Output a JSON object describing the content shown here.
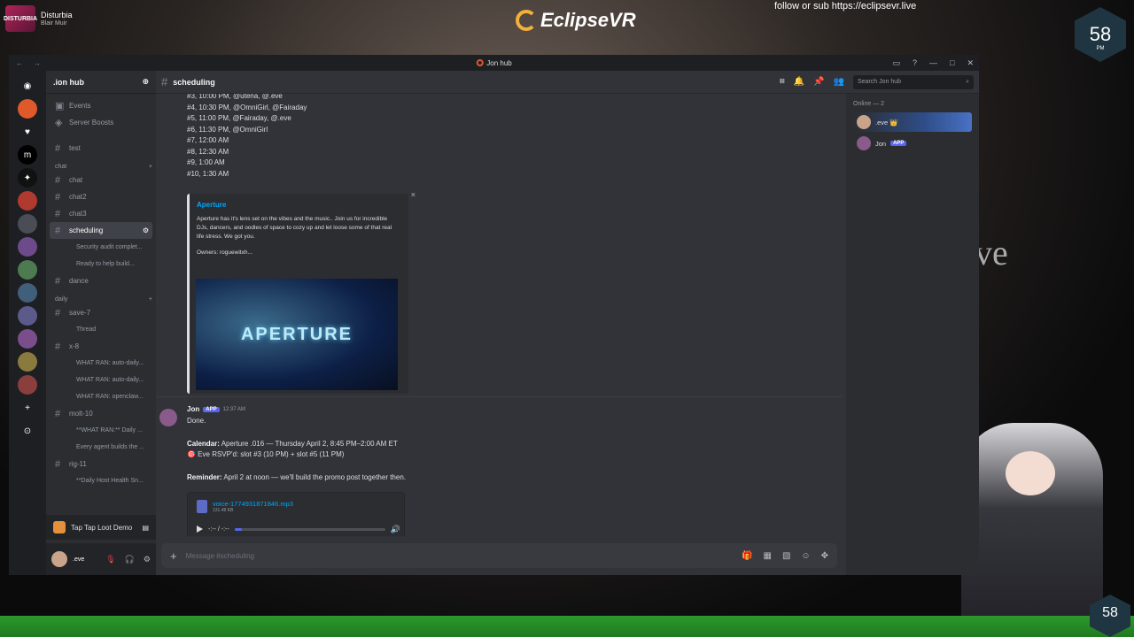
{
  "stream": {
    "channel_name": "Disturbia",
    "channel_sub": "Blair Muir",
    "avatar_text": "DISTURBIA",
    "logo": "EclipseVR",
    "follow_text": "follow or sub https://eclipsevr.live",
    "badge_number": "58",
    "badge_suffix": "PM",
    "badge_number_bottom": "58",
    "bg_text": "ve"
  },
  "window": {
    "title": "Jon hub"
  },
  "guild": {
    "name": ".ion hub",
    "items": [
      {
        "label": "Events"
      },
      {
        "label": "Server Boosts"
      }
    ],
    "channels_top": [
      {
        "label": "test"
      }
    ],
    "category_chat": "chat",
    "chat_channels": [
      {
        "label": "chat"
      },
      {
        "label": "chat2"
      },
      {
        "label": "chat3"
      },
      {
        "label": "scheduling"
      }
    ],
    "threads_sched": [
      {
        "label": "Security audit complet..."
      },
      {
        "label": "Ready to help build..."
      }
    ],
    "dance": "dance",
    "category_daily": "daily",
    "daily_channels": [
      {
        "label": "save-7"
      },
      {
        "label": "Thread"
      },
      {
        "label": "x-8"
      },
      {
        "label": "WHAT RAN: auto-daily..."
      },
      {
        "label": "WHAT RAN: auto-daily..."
      },
      {
        "label": "WHAT RAN: openclaw..."
      },
      {
        "label": "molt-10"
      },
      {
        "label": "**WHAT RAN:** Daily ..."
      },
      {
        "label": "Every agent builds the ..."
      },
      {
        "label": "rig-11"
      },
      {
        "label": "**Daily Host Health Sn..."
      }
    ]
  },
  "game_bar": {
    "label": "Tap Tap Loot Demo"
  },
  "user": {
    "name": ".eve"
  },
  "channel_header": {
    "name": "scheduling",
    "search_placeholder": "Search Jon hub"
  },
  "slots": [
    "#3, 10:00 PM, @utena, @.eve",
    "#4, 10:30 PM, @OmniGirl, @Fairaday",
    "#5, 11:00 PM, @Fairaday, @.eve",
    "#6, 11:30 PM, @OmniGirl",
    "#7, 12:00 AM",
    "#8, 12:30 AM",
    "#9, 1:00 AM",
    "#10, 1:30 AM"
  ],
  "embed": {
    "title": "Aperture",
    "description": "Aperture has it's lens set on the vibes and the music.. Join us for incredible DJs, dancers, and oodles of space to cozy up and let loose some of that real life stress. We got you.",
    "owners": "Owners: roguewitxh...",
    "image_text": "APERTURE",
    "close": "×"
  },
  "message": {
    "author": "Jon",
    "tag": "APP",
    "time": "12:37 AM",
    "line1": "Done.",
    "calendar_label": "Calendar:",
    "calendar_text": " Aperture .016 — Thursday April 2, 8:45 PM–2:00 AM ET",
    "rsvp_text": "🎯 Eve RSVP'd: slot #3 (10 PM) + slot #5 (11 PM)",
    "reminder_label": "Reminder:",
    "reminder_text": " April 2 at noon — we'll build the promo post together then."
  },
  "attachment": {
    "filename": "voice-1774931871846.mp3",
    "size": "131.48 KB",
    "time": "-:-- / -:--",
    "progress": 0.05
  },
  "composer": {
    "placeholder": "Message #scheduling"
  },
  "members": {
    "heading": "Online — 2",
    "list": [
      {
        "name": ".eve 👑"
      },
      {
        "name": "Jon",
        "tag": "APP"
      }
    ]
  },
  "colors": {
    "accent": "#5865f2",
    "link": "#00a8fc"
  }
}
